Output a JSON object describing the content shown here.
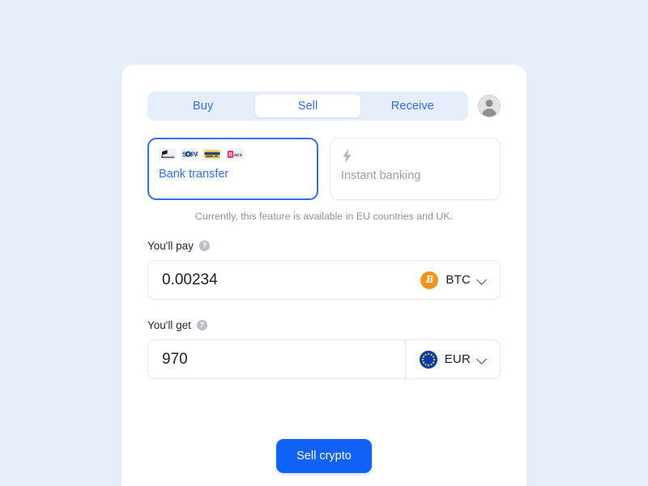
{
  "theme": {
    "page_bg": "#e6eefc",
    "card_bg": "#ffffff",
    "accent": "#2f6ff0",
    "button_bg": "#0f62f5",
    "muted_text": "#9aa0ab",
    "btc_color": "#f7931a",
    "eu_blue": "#0b3dad",
    "eu_star": "#f5d000"
  },
  "header": {
    "tabs": [
      {
        "label": "Buy",
        "active": false
      },
      {
        "label": "Sell",
        "active": true
      },
      {
        "label": "Receive",
        "active": false
      }
    ],
    "avatar": "avatar-icon"
  },
  "methods": {
    "bank_transfer": {
      "label": "Bank transfer",
      "selected": true,
      "badges": [
        "faster-payments-logo",
        "sepa-logo",
        "card-logo",
        "bacs-logo"
      ]
    },
    "instant_banking": {
      "label": "Instant banking",
      "selected": false,
      "icon": "lightning-bolt-icon"
    },
    "notice": "Currently, this feature is available in EU countries and UK."
  },
  "pay_field": {
    "label": "You'll pay",
    "help": "?",
    "value": "0.00234",
    "placeholder": "0.00",
    "currency": "BTC",
    "currency_symbol": "Ƀ",
    "chevron": "chevron-down-icon"
  },
  "get_field": {
    "label": "You'll get",
    "help": "?",
    "value": "970",
    "placeholder": "0",
    "currency": "EUR",
    "chevron": "chevron-down-icon"
  },
  "submit": {
    "label": "Sell crypto"
  }
}
